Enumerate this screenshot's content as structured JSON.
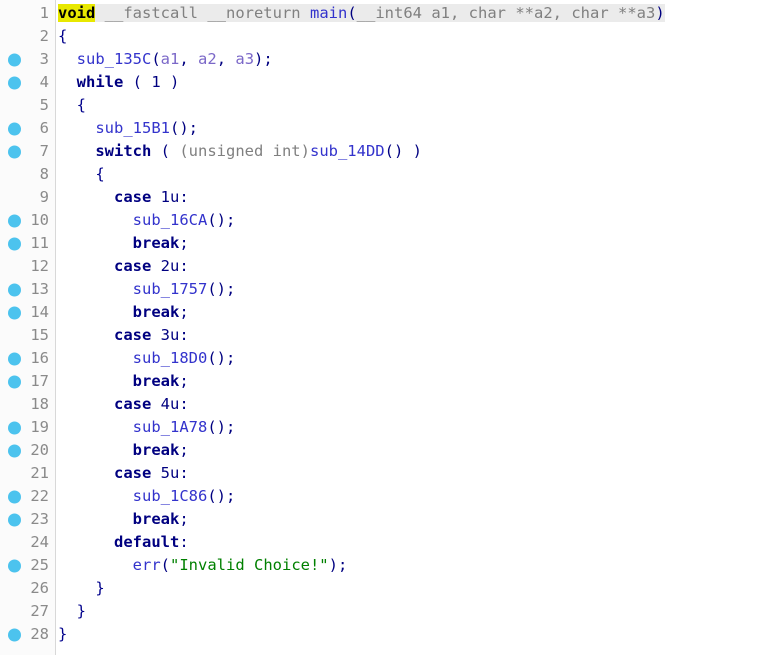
{
  "view": {
    "name": "decompiler-pseudocode",
    "title": "Pseudocode",
    "line_count": 28,
    "colors": {
      "background": "#ffffff",
      "gutter_background": "#fbfbfb",
      "gutter_border": "#d8d8d8",
      "line_number": "#8a8a8a",
      "breakpoint_dot": "#4cc3ee",
      "keyword": "#000080",
      "function": "#3333cc",
      "argument": "#7b68c8",
      "type_grey": "#808080",
      "string": "#008000",
      "brace": "#00008b",
      "highlight_word": "#e8e800",
      "active_line": "#ebebeb"
    }
  },
  "code": {
    "lines": [
      {
        "number": "1",
        "breakpoint": false,
        "line_highlight": true,
        "tokens": [
          {
            "t": "void",
            "c": "tok-kw hl-yellow"
          },
          {
            "t": " ",
            "c": "tok-plain"
          },
          {
            "t": "__fastcall __noreturn ",
            "c": "tok-type"
          },
          {
            "t": "main",
            "c": "tok-func"
          },
          {
            "t": "(",
            "c": "tok-punct"
          },
          {
            "t": "__int64 ",
            "c": "tok-type"
          },
          {
            "t": "a1",
            "c": "tok-type"
          },
          {
            "t": ", ",
            "c": "tok-type"
          },
          {
            "t": "char ",
            "c": "tok-type"
          },
          {
            "t": "**a2",
            "c": "tok-type"
          },
          {
            "t": ", ",
            "c": "tok-type"
          },
          {
            "t": "char ",
            "c": "tok-type"
          },
          {
            "t": "**a3",
            "c": "tok-type"
          },
          {
            "t": ")",
            "c": "tok-punct"
          }
        ]
      },
      {
        "number": "2",
        "breakpoint": false,
        "line_highlight": false,
        "tokens": [
          {
            "t": "{",
            "c": "tok-brace"
          }
        ]
      },
      {
        "number": "3",
        "breakpoint": true,
        "line_highlight": false,
        "tokens": [
          {
            "t": "  ",
            "c": "tok-plain"
          },
          {
            "t": "sub_135C",
            "c": "tok-func"
          },
          {
            "t": "(",
            "c": "tok-punct"
          },
          {
            "t": "a1",
            "c": "tok-arg"
          },
          {
            "t": ", ",
            "c": "tok-punct"
          },
          {
            "t": "a2",
            "c": "tok-arg"
          },
          {
            "t": ", ",
            "c": "tok-punct"
          },
          {
            "t": "a3",
            "c": "tok-arg"
          },
          {
            "t": ");",
            "c": "tok-punct"
          }
        ]
      },
      {
        "number": "4",
        "breakpoint": true,
        "line_highlight": false,
        "tokens": [
          {
            "t": "  ",
            "c": "tok-plain"
          },
          {
            "t": "while",
            "c": "tok-kw"
          },
          {
            "t": " ( ",
            "c": "tok-punct"
          },
          {
            "t": "1",
            "c": "tok-num"
          },
          {
            "t": " )",
            "c": "tok-punct"
          }
        ]
      },
      {
        "number": "5",
        "breakpoint": false,
        "line_highlight": false,
        "tokens": [
          {
            "t": "  ",
            "c": "tok-plain"
          },
          {
            "t": "{",
            "c": "tok-brace"
          }
        ]
      },
      {
        "number": "6",
        "breakpoint": true,
        "line_highlight": false,
        "tokens": [
          {
            "t": "    ",
            "c": "tok-plain"
          },
          {
            "t": "sub_15B1",
            "c": "tok-func"
          },
          {
            "t": "();",
            "c": "tok-punct"
          }
        ]
      },
      {
        "number": "7",
        "breakpoint": true,
        "line_highlight": false,
        "tokens": [
          {
            "t": "    ",
            "c": "tok-plain"
          },
          {
            "t": "switch",
            "c": "tok-kw"
          },
          {
            "t": " ( ",
            "c": "tok-punct"
          },
          {
            "t": "(unsigned int)",
            "c": "tok-type"
          },
          {
            "t": "sub_14DD",
            "c": "tok-func"
          },
          {
            "t": "() )",
            "c": "tok-punct"
          }
        ]
      },
      {
        "number": "8",
        "breakpoint": false,
        "line_highlight": false,
        "tokens": [
          {
            "t": "    ",
            "c": "tok-plain"
          },
          {
            "t": "{",
            "c": "tok-brace"
          }
        ]
      },
      {
        "number": "9",
        "breakpoint": false,
        "line_highlight": false,
        "tokens": [
          {
            "t": "      ",
            "c": "tok-plain"
          },
          {
            "t": "case",
            "c": "tok-kw"
          },
          {
            "t": " ",
            "c": "tok-plain"
          },
          {
            "t": "1u",
            "c": "tok-num"
          },
          {
            "t": ":",
            "c": "tok-punct"
          }
        ]
      },
      {
        "number": "10",
        "breakpoint": true,
        "line_highlight": false,
        "tokens": [
          {
            "t": "        ",
            "c": "tok-plain"
          },
          {
            "t": "sub_16CA",
            "c": "tok-func"
          },
          {
            "t": "();",
            "c": "tok-punct"
          }
        ]
      },
      {
        "number": "11",
        "breakpoint": true,
        "line_highlight": false,
        "tokens": [
          {
            "t": "        ",
            "c": "tok-plain"
          },
          {
            "t": "break",
            "c": "tok-kw"
          },
          {
            "t": ";",
            "c": "tok-punct"
          }
        ]
      },
      {
        "number": "12",
        "breakpoint": false,
        "line_highlight": false,
        "tokens": [
          {
            "t": "      ",
            "c": "tok-plain"
          },
          {
            "t": "case",
            "c": "tok-kw"
          },
          {
            "t": " ",
            "c": "tok-plain"
          },
          {
            "t": "2u",
            "c": "tok-num"
          },
          {
            "t": ":",
            "c": "tok-punct"
          }
        ]
      },
      {
        "number": "13",
        "breakpoint": true,
        "line_highlight": false,
        "tokens": [
          {
            "t": "        ",
            "c": "tok-plain"
          },
          {
            "t": "sub_1757",
            "c": "tok-func"
          },
          {
            "t": "();",
            "c": "tok-punct"
          }
        ]
      },
      {
        "number": "14",
        "breakpoint": true,
        "line_highlight": false,
        "tokens": [
          {
            "t": "        ",
            "c": "tok-plain"
          },
          {
            "t": "break",
            "c": "tok-kw"
          },
          {
            "t": ";",
            "c": "tok-punct"
          }
        ]
      },
      {
        "number": "15",
        "breakpoint": false,
        "line_highlight": false,
        "tokens": [
          {
            "t": "      ",
            "c": "tok-plain"
          },
          {
            "t": "case",
            "c": "tok-kw"
          },
          {
            "t": " ",
            "c": "tok-plain"
          },
          {
            "t": "3u",
            "c": "tok-num"
          },
          {
            "t": ":",
            "c": "tok-punct"
          }
        ]
      },
      {
        "number": "16",
        "breakpoint": true,
        "line_highlight": false,
        "tokens": [
          {
            "t": "        ",
            "c": "tok-plain"
          },
          {
            "t": "sub_18D0",
            "c": "tok-func"
          },
          {
            "t": "();",
            "c": "tok-punct"
          }
        ]
      },
      {
        "number": "17",
        "breakpoint": true,
        "line_highlight": false,
        "tokens": [
          {
            "t": "        ",
            "c": "tok-plain"
          },
          {
            "t": "break",
            "c": "tok-kw"
          },
          {
            "t": ";",
            "c": "tok-punct"
          }
        ]
      },
      {
        "number": "18",
        "breakpoint": false,
        "line_highlight": false,
        "tokens": [
          {
            "t": "      ",
            "c": "tok-plain"
          },
          {
            "t": "case",
            "c": "tok-kw"
          },
          {
            "t": " ",
            "c": "tok-plain"
          },
          {
            "t": "4u",
            "c": "tok-num"
          },
          {
            "t": ":",
            "c": "tok-punct"
          }
        ]
      },
      {
        "number": "19",
        "breakpoint": true,
        "line_highlight": false,
        "tokens": [
          {
            "t": "        ",
            "c": "tok-plain"
          },
          {
            "t": "sub_1A78",
            "c": "tok-func"
          },
          {
            "t": "();",
            "c": "tok-punct"
          }
        ]
      },
      {
        "number": "20",
        "breakpoint": true,
        "line_highlight": false,
        "tokens": [
          {
            "t": "        ",
            "c": "tok-plain"
          },
          {
            "t": "break",
            "c": "tok-kw"
          },
          {
            "t": ";",
            "c": "tok-punct"
          }
        ]
      },
      {
        "number": "21",
        "breakpoint": false,
        "line_highlight": false,
        "tokens": [
          {
            "t": "      ",
            "c": "tok-plain"
          },
          {
            "t": "case",
            "c": "tok-kw"
          },
          {
            "t": " ",
            "c": "tok-plain"
          },
          {
            "t": "5u",
            "c": "tok-num"
          },
          {
            "t": ":",
            "c": "tok-punct"
          }
        ]
      },
      {
        "number": "22",
        "breakpoint": true,
        "line_highlight": false,
        "tokens": [
          {
            "t": "        ",
            "c": "tok-plain"
          },
          {
            "t": "sub_1C86",
            "c": "tok-func"
          },
          {
            "t": "();",
            "c": "tok-punct"
          }
        ]
      },
      {
        "number": "23",
        "breakpoint": true,
        "line_highlight": false,
        "tokens": [
          {
            "t": "        ",
            "c": "tok-plain"
          },
          {
            "t": "break",
            "c": "tok-kw"
          },
          {
            "t": ";",
            "c": "tok-punct"
          }
        ]
      },
      {
        "number": "24",
        "breakpoint": false,
        "line_highlight": false,
        "tokens": [
          {
            "t": "      ",
            "c": "tok-plain"
          },
          {
            "t": "default",
            "c": "tok-kw"
          },
          {
            "t": ":",
            "c": "tok-punct"
          }
        ]
      },
      {
        "number": "25",
        "breakpoint": true,
        "line_highlight": false,
        "tokens": [
          {
            "t": "        ",
            "c": "tok-plain"
          },
          {
            "t": "err",
            "c": "tok-func"
          },
          {
            "t": "(",
            "c": "tok-punct"
          },
          {
            "t": "\"Invalid Choice!\"",
            "c": "tok-string"
          },
          {
            "t": ");",
            "c": "tok-punct"
          }
        ]
      },
      {
        "number": "26",
        "breakpoint": false,
        "line_highlight": false,
        "tokens": [
          {
            "t": "    ",
            "c": "tok-plain"
          },
          {
            "t": "}",
            "c": "tok-brace"
          }
        ]
      },
      {
        "number": "27",
        "breakpoint": false,
        "line_highlight": false,
        "tokens": [
          {
            "t": "  ",
            "c": "tok-plain"
          },
          {
            "t": "}",
            "c": "tok-brace"
          }
        ]
      },
      {
        "number": "28",
        "breakpoint": true,
        "line_highlight": false,
        "tokens": [
          {
            "t": "}",
            "c": "tok-brace"
          }
        ]
      }
    ]
  }
}
